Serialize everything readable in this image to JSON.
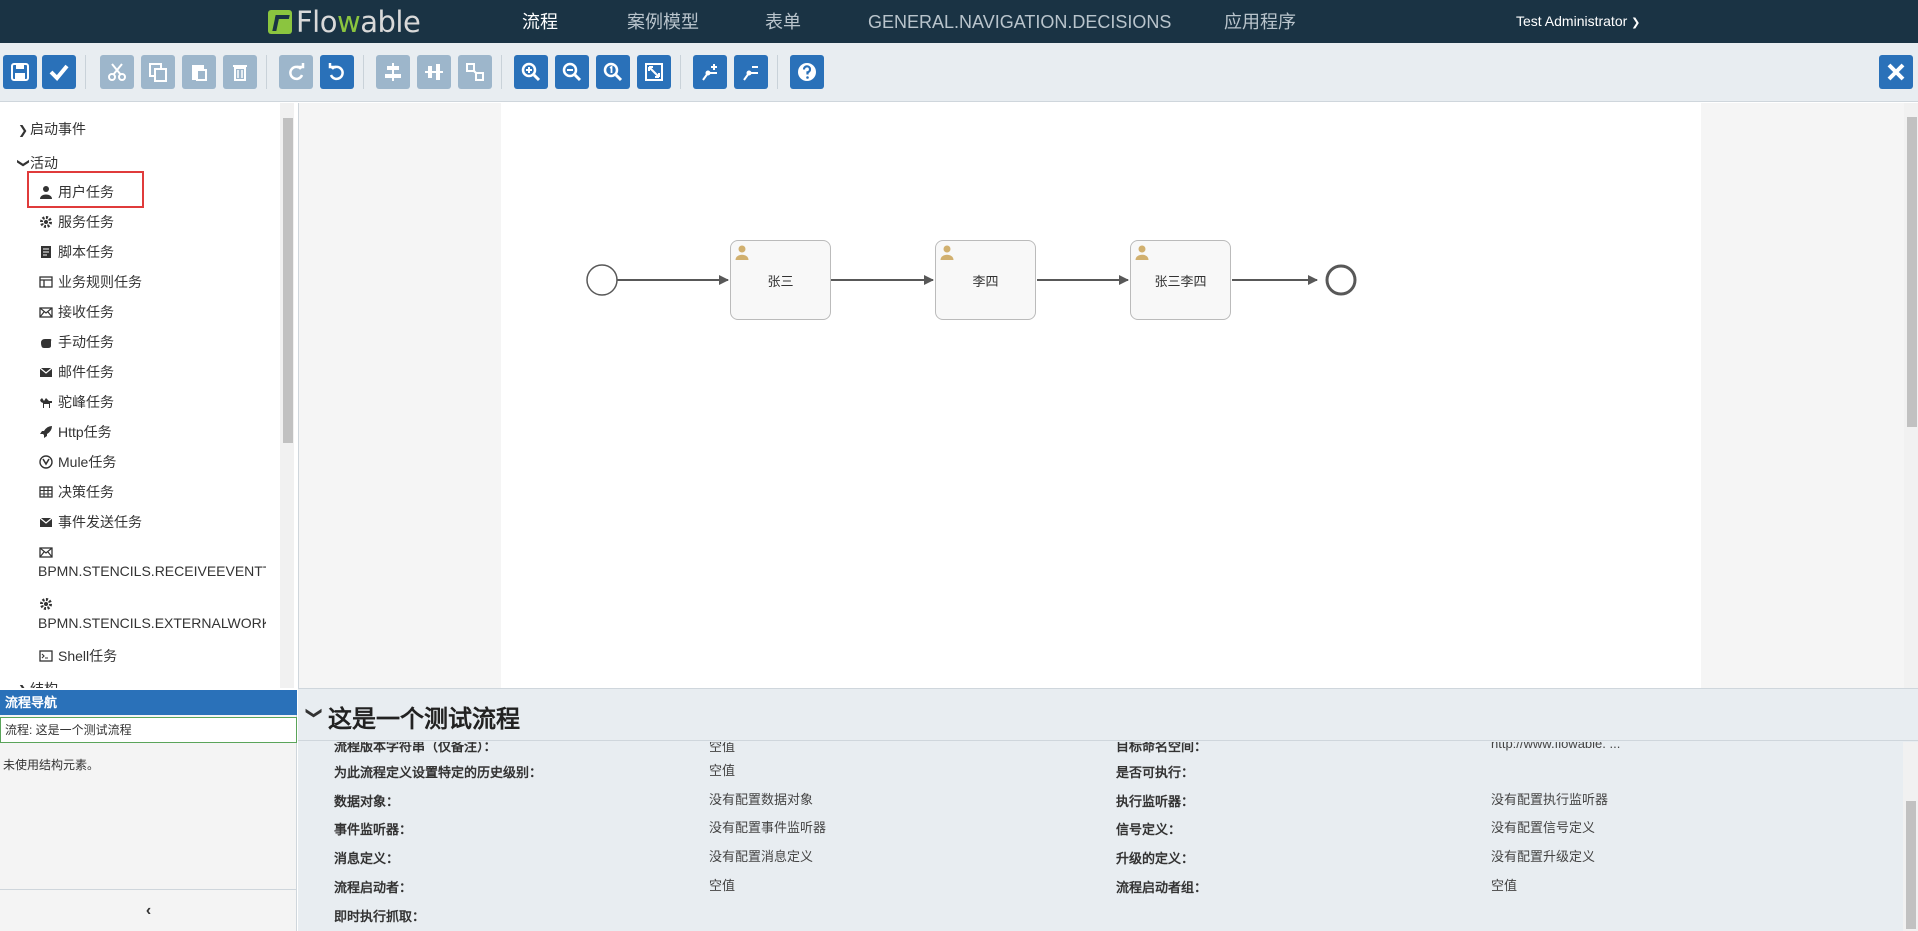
{
  "app": {
    "logo": {
      "part1": "Flo",
      "part2": "w",
      "part3": "able"
    },
    "nav": [
      {
        "label": "流程",
        "active": true
      },
      {
        "label": "案例模型",
        "active": false
      },
      {
        "label": "表单",
        "active": false
      },
      {
        "label": "GENERAL.NAVIGATION.DECISIONS",
        "active": false
      },
      {
        "label": "应用程序",
        "active": false
      }
    ],
    "user": "Test Administrator",
    "accent": "#2a71b9",
    "nav_bg": "#1a3344"
  },
  "toolbar": {
    "buttons": [
      "save-icon",
      "check-icon",
      "scissors-icon",
      "copy-icon",
      "paste-icon",
      "trash-icon",
      "redo-icon",
      "undo-icon",
      "align-horizontal-icon",
      "align-vertical-icon",
      "same-size-icon",
      "zoom-in-icon",
      "zoom-out-icon",
      "zoom-actual-icon",
      "zoom-fit-icon",
      "bend-point-add-icon",
      "bend-point-remove-icon",
      "help-icon",
      "close-icon"
    ]
  },
  "palette": {
    "categories": [
      {
        "label": "启动事件",
        "expanded": false
      },
      {
        "label": "活动",
        "expanded": true
      },
      {
        "label": "结构",
        "expanded": false
      }
    ],
    "items": [
      {
        "label": "用户任务",
        "icon": "user-icon"
      },
      {
        "label": "服务任务",
        "icon": "gear-icon"
      },
      {
        "label": "脚本任务",
        "icon": "script-icon"
      },
      {
        "label": "业务规则任务",
        "icon": "table-icon"
      },
      {
        "label": "接收任务",
        "icon": "envelope-open-icon"
      },
      {
        "label": "手动任务",
        "icon": "hand-icon"
      },
      {
        "label": "邮件任务",
        "icon": "envelope-icon"
      },
      {
        "label": "驼峰任务",
        "icon": "camel-icon"
      },
      {
        "label": "Http任务",
        "icon": "rocket-icon"
      },
      {
        "label": "Mule任务",
        "icon": "mule-icon"
      },
      {
        "label": "决策任务",
        "icon": "grid-icon"
      },
      {
        "label": "事件发送任务",
        "icon": "envelope-icon"
      },
      {
        "label": "BPMN.STENCILS.RECEIVEEVENTTASK",
        "icon": "envelope-open-icon"
      },
      {
        "label": "BPMN.STENCILS.EXTERNALWORKERTASK",
        "icon": "gear-icon"
      },
      {
        "label": "Shell任务",
        "icon": "terminal-icon"
      }
    ]
  },
  "navigator": {
    "title": "流程导航",
    "process": "流程: 这是一个测试流程",
    "empty": "未使用结构元素。",
    "collapse": "‹"
  },
  "diagram": {
    "tasks": [
      {
        "label": "张三"
      },
      {
        "label": "李四"
      },
      {
        "label": "张三李四"
      }
    ]
  },
  "properties": {
    "title": "这是一个测试流程",
    "rows": [
      {
        "l1": "流程版本字符串（仅备注）：",
        "v1": "空值",
        "l2": "目标命名空间：",
        "v2": "http://www.flowable. ..."
      },
      {
        "l1": "为此流程定义设置特定的历史级别：",
        "v1": "空值",
        "l2": "是否可执行：",
        "v2": ""
      },
      {
        "l1": "数据对象：",
        "v1": "没有配置数据对象",
        "l2": "执行监听器：",
        "v2": "没有配置执行监听器"
      },
      {
        "l1": "事件监听器：",
        "v1": "没有配置事件监听器",
        "l2": "信号定义：",
        "v2": "没有配置信号定义"
      },
      {
        "l1": "消息定义：",
        "v1": "没有配置消息定义",
        "l2": "升级的定义：",
        "v2": "没有配置升级定义"
      },
      {
        "l1": "流程启动者：",
        "v1": "空值",
        "l2": "流程启动者组：",
        "v2": "空值"
      },
      {
        "l1": "即时执行抓取：",
        "v1": "",
        "l2": "",
        "v2": ""
      }
    ]
  }
}
